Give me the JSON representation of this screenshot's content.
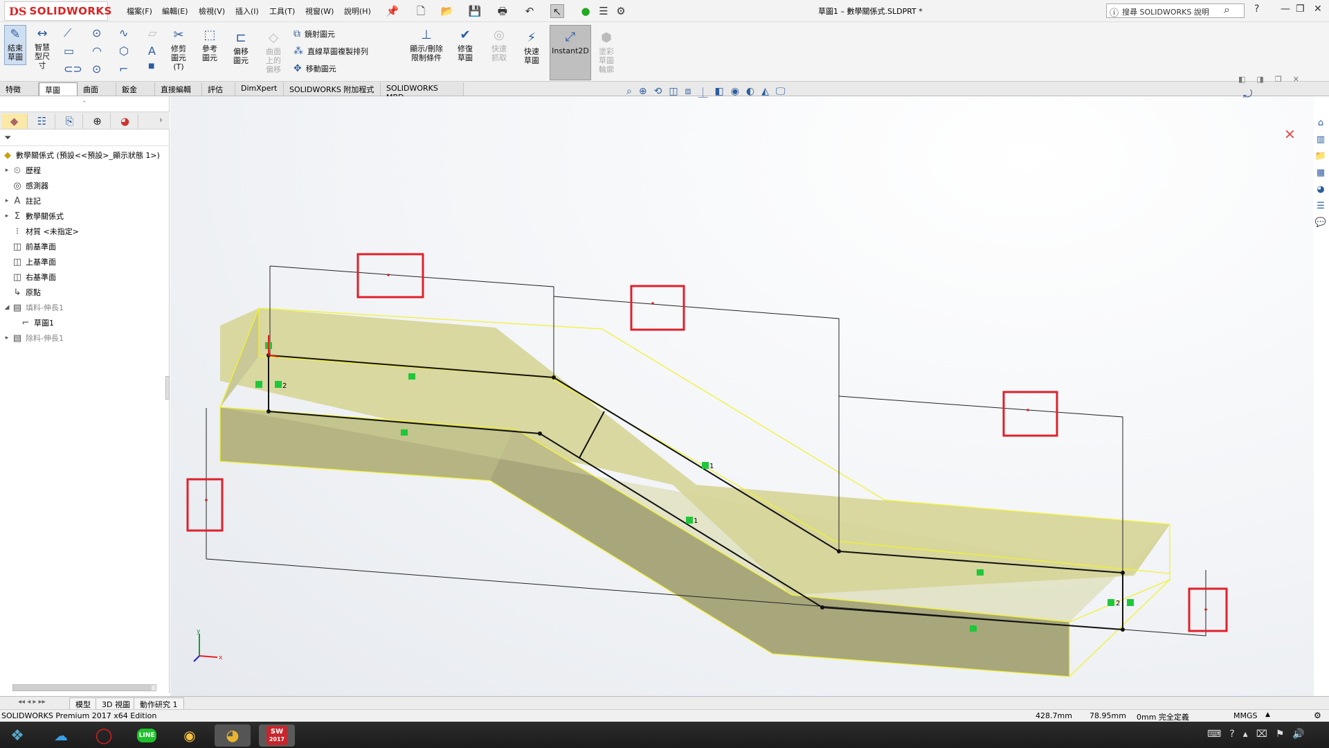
{
  "app": {
    "logo_prefix": "DS",
    "logo_name": "SOLIDWORKS",
    "doc_title": "草圖1 – 數學關係式.SLDPRT *",
    "search_placeholder": "搜尋 SOLIDWORKS 說明"
  },
  "menu": [
    "檔案(F)",
    "編輯(E)",
    "檢視(V)",
    "插入(I)",
    "工具(T)",
    "視窗(W)",
    "說明(H)"
  ],
  "ribbon": {
    "exit_sketch": "結束草圖",
    "smart_dim": "智慧型尺寸",
    "trim": "修剪圖元(T)",
    "convert": "參考圖元",
    "offset": "偏移圖元",
    "offset_surface": "曲面上的偏移",
    "mirror": "鏡射圖元",
    "linear_pattern": "直線草圖複製排列",
    "move": "移動圖元",
    "relations": "顯示/刪除限制條件",
    "repair": "修復草圖",
    "quick_snaps": "快速抓取",
    "rapid_sketch": "快速草圖",
    "instant2d": "Instant2D",
    "shaded_contours": "塗彩草圖輪廓"
  },
  "tabs": [
    "特徵",
    "草圖",
    "曲面",
    "鈑金",
    "直接編輯",
    "評估",
    "DimXpert",
    "SOLIDWORKS 附加程式",
    "SOLIDWORKS MBD"
  ],
  "active_tab": "草圖",
  "tree": {
    "root": "數學關係式 (預設<<預設>_顯示狀態 1>)",
    "items": [
      {
        "label": "歷程",
        "expand": true
      },
      {
        "label": "感測器",
        "expand": false
      },
      {
        "label": "註記",
        "expand": true
      },
      {
        "label": "數學關係式",
        "expand": true
      },
      {
        "label": "材質 <未指定>",
        "expand": false
      },
      {
        "label": "前基準面",
        "expand": false
      },
      {
        "label": "上基準面",
        "expand": false
      },
      {
        "label": "右基準面",
        "expand": false
      },
      {
        "label": "原點",
        "expand": false
      },
      {
        "label": "填料-伸長1",
        "expand": true,
        "open": true,
        "dim": true
      },
      {
        "label": "草圖1",
        "expand": false,
        "child": true
      },
      {
        "label": "除料-伸長1",
        "expand": true,
        "dim": true
      }
    ]
  },
  "bottom_tabs": [
    "模型",
    "3D 視圖",
    "動作研究 1"
  ],
  "status": {
    "edition": "SOLIDWORKS Premium 2017 x64 Edition",
    "x": "428.7mm",
    "y": "78.95mm",
    "z": "0mm 完全定義",
    "units": "MMGS"
  },
  "relation_labels": {
    "parallel": "2",
    "colinear": "1"
  },
  "axis": {
    "x": "x",
    "y": "y"
  },
  "taskbar": {
    "solidworks_badge": "SW",
    "solidworks_year": "2017",
    "line": "LINE"
  }
}
